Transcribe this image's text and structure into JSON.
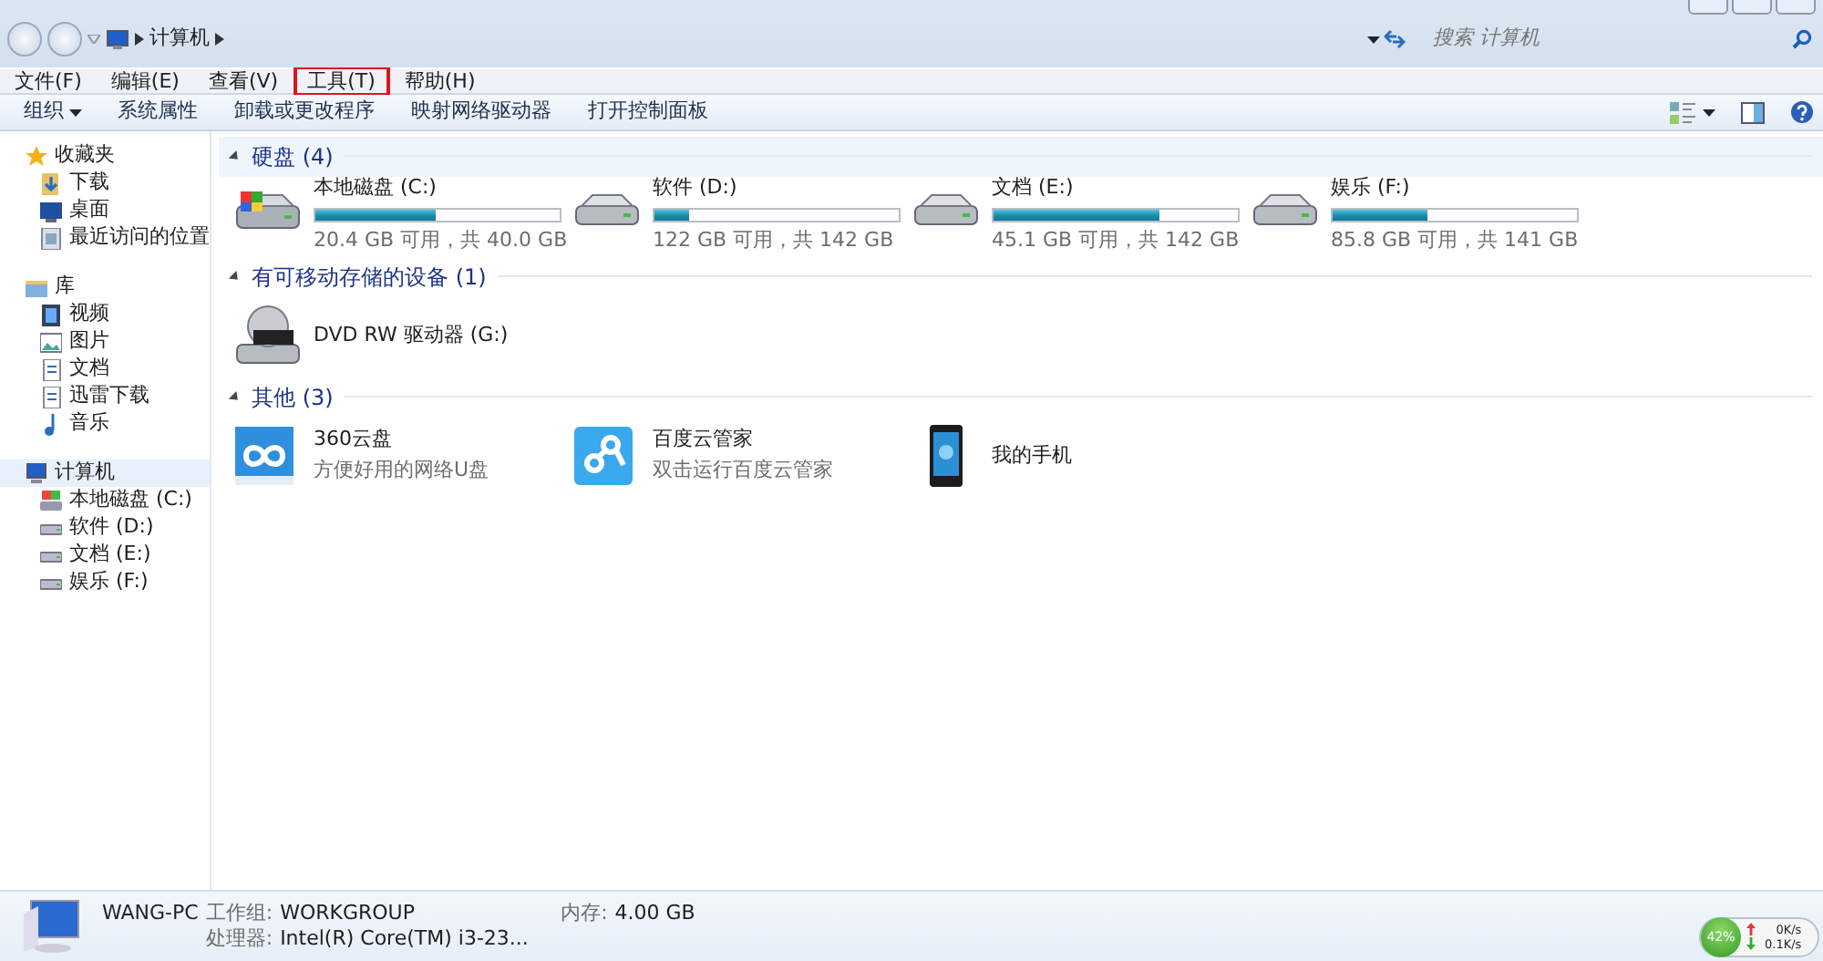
{
  "address_bar": {
    "crumbs": [
      "计算机"
    ],
    "search": {
      "placeholder": "搜索 计算机"
    }
  },
  "menu": [
    {
      "label": "文件(F)",
      "highlighted": false
    },
    {
      "label": "编辑(E)",
      "highlighted": false
    },
    {
      "label": "查看(V)",
      "highlighted": false
    },
    {
      "label": "工具(T)",
      "highlighted": true
    },
    {
      "label": "帮助(H)",
      "highlighted": false
    }
  ],
  "toolbar": [
    {
      "label": "组织",
      "dropdown": true
    },
    {
      "label": "系统属性",
      "dropdown": false
    },
    {
      "label": "卸载或更改程序",
      "dropdown": false
    },
    {
      "label": "映射网络驱动器",
      "dropdown": false
    },
    {
      "label": "打开控制面板",
      "dropdown": false
    }
  ],
  "sidebar": [
    {
      "label": "收藏夹",
      "kind": "star",
      "selected": false,
      "children": [
        {
          "label": "下载",
          "kind": "download",
          "selected": false
        },
        {
          "label": "桌面",
          "kind": "desktop",
          "selected": false
        },
        {
          "label": "最近访问的位置",
          "kind": "recent",
          "selected": false
        }
      ]
    },
    {
      "label": "库",
      "kind": "library",
      "selected": false,
      "children": [
        {
          "label": "视频",
          "kind": "video",
          "selected": false
        },
        {
          "label": "图片",
          "kind": "picture",
          "selected": false
        },
        {
          "label": "文档",
          "kind": "document",
          "selected": false
        },
        {
          "label": "迅雷下载",
          "kind": "document",
          "selected": false
        },
        {
          "label": "音乐",
          "kind": "music",
          "selected": false
        }
      ]
    },
    {
      "label": "计算机",
      "kind": "computer",
      "selected": true,
      "children": [
        {
          "label": "本地磁盘 (C:)",
          "kind": "system_drive",
          "selected": false
        },
        {
          "label": "软件 (D:)",
          "kind": "drive",
          "selected": false
        },
        {
          "label": "文档 (E:)",
          "kind": "drive",
          "selected": false
        },
        {
          "label": "娱乐 (F:)",
          "kind": "drive",
          "selected": false
        }
      ]
    }
  ],
  "sections": [
    {
      "title": "硬盘 (4)",
      "items": [
        {
          "kind": "system_drive",
          "name": "本地磁盘 (C:)",
          "level": 0.49,
          "detail": "20.4 GB 可用，共 40.0 GB"
        },
        {
          "kind": "drive",
          "name": "软件 (D:)",
          "level": 0.14,
          "detail": "122 GB 可用，共 142 GB"
        },
        {
          "kind": "drive",
          "name": "文档 (E:)",
          "level": 0.68,
          "detail": "45.1 GB 可用，共 142 GB"
        },
        {
          "kind": "drive",
          "name": "娱乐 (F:)",
          "level": 0.39,
          "detail": "85.8 GB 可用，共 141 GB"
        }
      ]
    },
    {
      "title": "有可移动存储的设备 (1)",
      "items": [
        {
          "kind": "dvd",
          "name": "DVD RW 驱动器 (G:)"
        }
      ]
    },
    {
      "title": "其他 (3)",
      "items": [
        {
          "kind": "cloud",
          "name": "360云盘",
          "detail": "方便好用的网络U盘"
        },
        {
          "kind": "baidu",
          "name": "百度云管家",
          "detail": "双击运行百度云管家"
        },
        {
          "kind": "phone",
          "name": "我的手机"
        }
      ]
    }
  ],
  "details": {
    "computer_name": "WANG-PC",
    "fields": [
      {
        "label": "工作组:",
        "value": "WORKGROUP"
      },
      {
        "label": "内存:",
        "value": "4.00 GB"
      },
      {
        "label": "处理器:",
        "value": "Intel(R) Core(TM) i3-23..."
      }
    ]
  },
  "network_widget": {
    "percent": "42%",
    "upload": "0K/s",
    "download": "0.1K/s"
  }
}
